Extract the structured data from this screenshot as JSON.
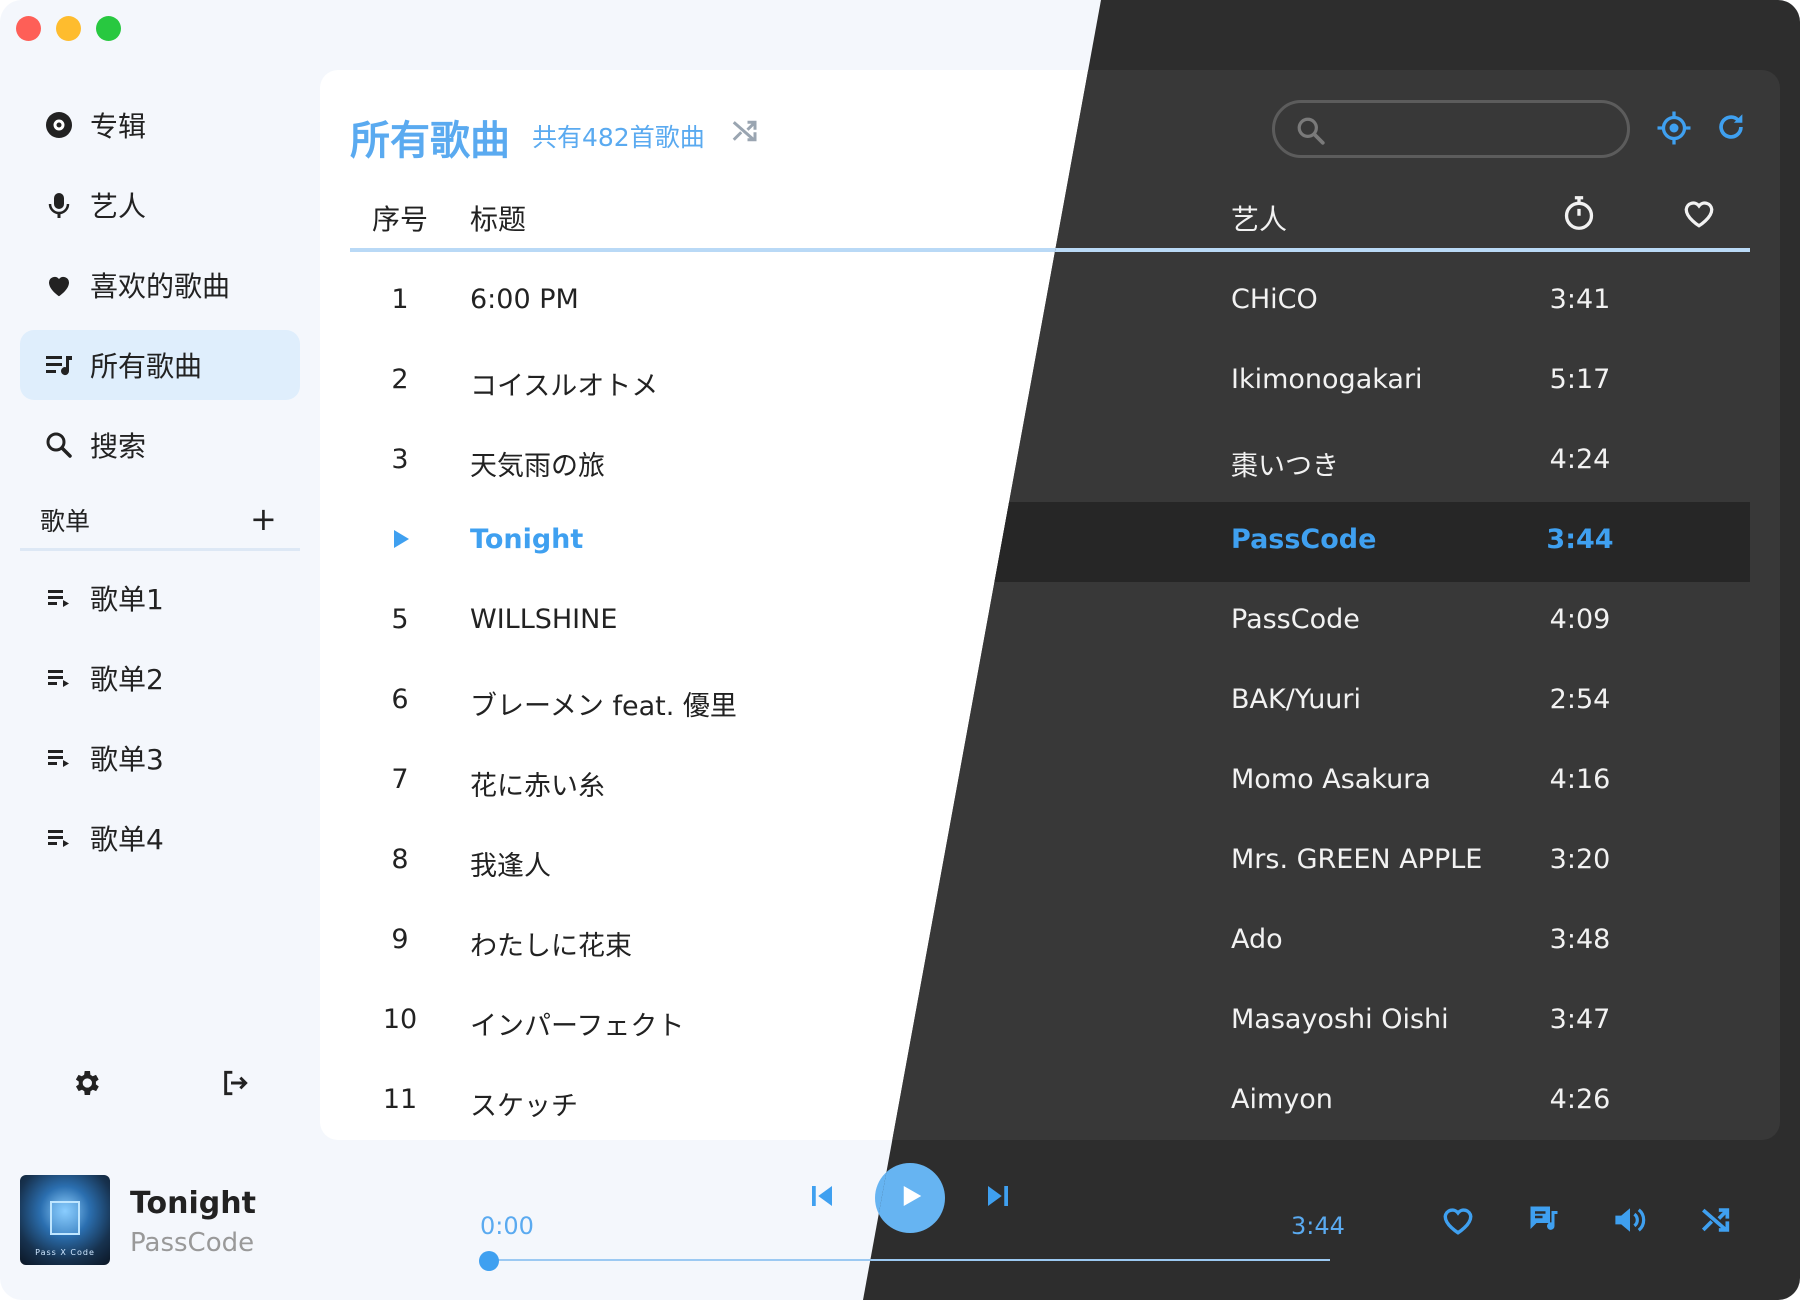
{
  "sidebar": {
    "nav": [
      {
        "label": "专辑",
        "icon": "album-icon"
      },
      {
        "label": "艺人",
        "icon": "microphone-icon"
      },
      {
        "label": "喜欢的歌曲",
        "icon": "heart-icon"
      },
      {
        "label": "所有歌曲",
        "icon": "music-list-icon",
        "active": true
      },
      {
        "label": "搜索",
        "icon": "search-icon"
      }
    ],
    "playlists_header": "歌单",
    "add_symbol": "+",
    "playlists": [
      "歌单1",
      "歌单2",
      "歌单3",
      "歌单4"
    ],
    "footer_icons": [
      "gear-icon",
      "logout-icon"
    ]
  },
  "main": {
    "title": "所有歌曲",
    "subtitle": "共有482首歌曲",
    "search_placeholder": "",
    "columns": {
      "num": "序号",
      "title": "标题",
      "artist": "艺人",
      "duration_icon": "stopwatch-icon",
      "favorite_icon": "heart-outline-icon"
    },
    "songs": [
      {
        "num": "1",
        "title": "6:00 PM",
        "artist": "CHiCO",
        "duration": "3:41"
      },
      {
        "num": "2",
        "title": "コイスルオトメ",
        "artist": "Ikimonogakari",
        "duration": "5:17"
      },
      {
        "num": "3",
        "title": "天気雨の旅",
        "artist": "棗いつき",
        "duration": "4:24"
      },
      {
        "num": "",
        "title": "Tonight",
        "artist": "PassCode",
        "duration": "3:44",
        "playing": true
      },
      {
        "num": "5",
        "title": "WILLSHINE",
        "artist": "PassCode",
        "duration": "4:09"
      },
      {
        "num": "6",
        "title": "ブレーメン feat. 優里",
        "artist": "BAK/Yuuri",
        "duration": "2:54"
      },
      {
        "num": "7",
        "title": "花に赤い糸",
        "artist": "Momo Asakura",
        "duration": "4:16"
      },
      {
        "num": "8",
        "title": "我逢人",
        "artist": "Mrs. GREEN APPLE",
        "duration": "3:20"
      },
      {
        "num": "9",
        "title": "わたしに花束",
        "artist": "Ado",
        "duration": "3:48"
      },
      {
        "num": "10",
        "title": "インパーフェクト",
        "artist": "Masayoshi Oishi",
        "duration": "3:47"
      },
      {
        "num": "11",
        "title": "スケッチ",
        "artist": "Aimyon",
        "duration": "4:26"
      }
    ]
  },
  "player": {
    "title": "Tonight",
    "artist": "PassCode",
    "cover_text": "Pass X Code",
    "current_time": "0:00",
    "total_time": "3:44",
    "progress": 0.0
  },
  "colors": {
    "accent": "#3fa0f0",
    "light_bg": "#f4f7fc",
    "dark_bg": "#2d2d2d",
    "active_nav": "#dfeefc"
  }
}
